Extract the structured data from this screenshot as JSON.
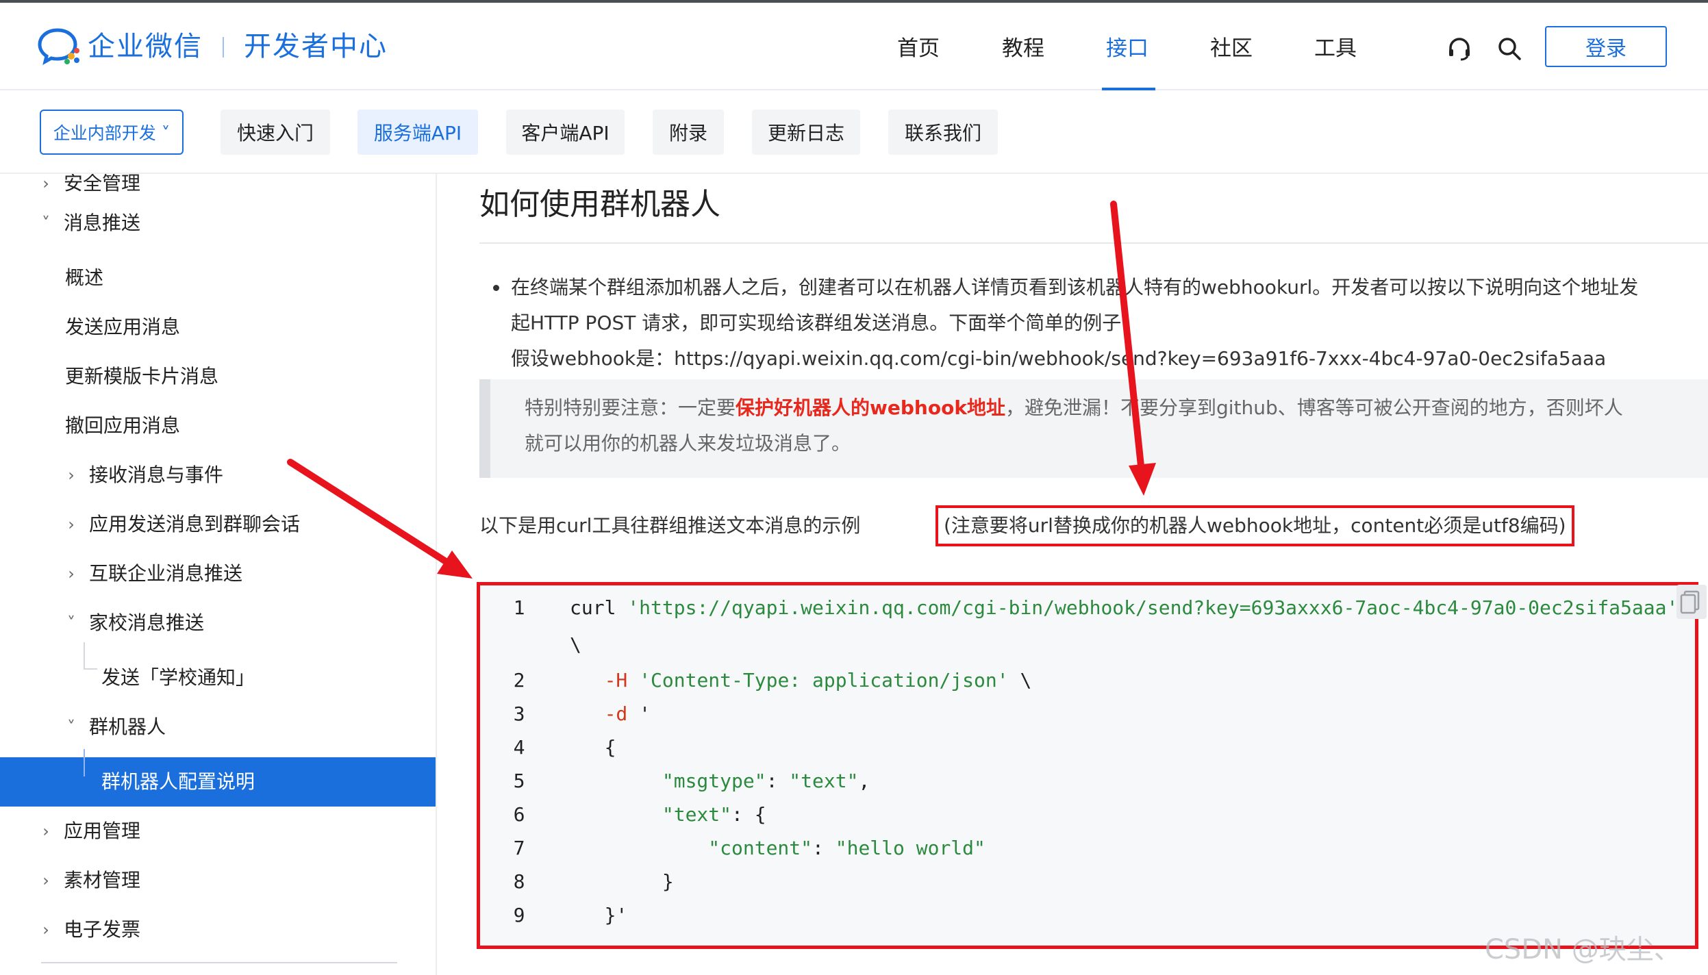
{
  "header": {
    "brand": "企业微信",
    "subbrand": "开发者中心",
    "nav": [
      "首页",
      "教程",
      "接口",
      "社区",
      "工具"
    ],
    "active_nav": "接口",
    "login": "登录",
    "icons": [
      "headset-icon",
      "search-icon"
    ]
  },
  "subnav": {
    "dev_select": "企业内部开发 ˅",
    "tabs": [
      "快速入门",
      "服务端API",
      "客户端API",
      "附录",
      "更新日志",
      "联系我们"
    ],
    "active_tab": "服务端API"
  },
  "sidebar": {
    "items": [
      {
        "label": "安全管理",
        "level": 0,
        "chevron": "›"
      },
      {
        "label": "消息推送",
        "level": 0,
        "chevron": "˅"
      },
      {
        "label": "概述",
        "level": 1,
        "chevron": ""
      },
      {
        "label": "发送应用消息",
        "level": 1,
        "chevron": ""
      },
      {
        "label": "更新模版卡片消息",
        "level": 1,
        "chevron": ""
      },
      {
        "label": "撤回应用消息",
        "level": 1,
        "chevron": ""
      },
      {
        "label": "接收消息与事件",
        "level": 1,
        "chevron": "›"
      },
      {
        "label": "应用发送消息到群聊会话",
        "level": 1,
        "chevron": "›"
      },
      {
        "label": "互联企业消息推送",
        "level": 1,
        "chevron": "›"
      },
      {
        "label": "家校消息推送",
        "level": 1,
        "chevron": "˅"
      },
      {
        "label": "发送「学校通知」",
        "level": 2,
        "chevron": ""
      },
      {
        "label": "群机器人",
        "level": 1,
        "chevron": "˅"
      },
      {
        "label": "群机器人配置说明",
        "level": 2,
        "chevron": ""
      },
      {
        "label": "应用管理",
        "level": 0,
        "chevron": "›"
      },
      {
        "label": "素材管理",
        "level": 0,
        "chevron": "›"
      },
      {
        "label": "电子发票",
        "level": 0,
        "chevron": "›"
      }
    ],
    "active_item": "群机器人配置说明"
  },
  "content": {
    "title": "如何使用群机器人",
    "para_line1": "在终端某个群组添加机器人之后，创建者可以在机器人详情页看到该机器人特有的webhookurl。开发者可以按以下说明向这个地址发",
    "para_line2": "起HTTP POST 请求，即可实现给该群组发送消息。下面举个简单的例子.",
    "para_line3": "假设webhook是：https://qyapi.weixin.qq.com/cgi-bin/webhook/send?key=693a91f6-7xxx-4bc4-97a0-0ec2sifa5aaa",
    "note_prefix": "特别特别要注意：一定要",
    "note_bold": "保护好机器人的webhook地址",
    "note_suffix": "，避免泄漏！不要分享到github、博客等可被公开查阅的地方，否则坏人",
    "note_line2": "就可以用你的机器人来发垃圾消息了。",
    "curl_intro": "以下是用curl工具往群组推送文本消息的示例",
    "curl_note": "(注意要将url替换成你的机器人webhook地址，content必须是utf8编码)"
  },
  "code": {
    "lines": [
      {
        "n": "1",
        "parts": [
          {
            "t": "curl ",
            "c": "plain"
          },
          {
            "t": "'https://qyapi.weixin.qq.com/cgi-bin/webhook/send?key=693axxx6-7aoc-4bc4-97a0-0ec2sifa5aaa'",
            "c": "str"
          }
        ]
      },
      {
        "n": "",
        "parts": [
          {
            "t": "\\",
            "c": "plain"
          }
        ]
      },
      {
        "n": "2",
        "parts": [
          {
            "t": "   -H ",
            "c": "red"
          },
          {
            "t": "'Content-Type: application/json'",
            "c": "str"
          },
          {
            "t": " \\",
            "c": "plain"
          }
        ]
      },
      {
        "n": "3",
        "parts": [
          {
            "t": "   -d ",
            "c": "red"
          },
          {
            "t": "'",
            "c": "plain"
          }
        ]
      },
      {
        "n": "4",
        "parts": [
          {
            "t": "   {",
            "c": "plain"
          }
        ]
      },
      {
        "n": "5",
        "parts": [
          {
            "t": "        \"msgtype\"",
            "c": "key"
          },
          {
            "t": ": ",
            "c": "plain"
          },
          {
            "t": "\"text\"",
            "c": "str"
          },
          {
            "t": ",",
            "c": "plain"
          }
        ]
      },
      {
        "n": "6",
        "parts": [
          {
            "t": "        \"text\"",
            "c": "key"
          },
          {
            "t": ": {",
            "c": "plain"
          }
        ]
      },
      {
        "n": "7",
        "parts": [
          {
            "t": "            \"content\"",
            "c": "key"
          },
          {
            "t": ": ",
            "c": "plain"
          },
          {
            "t": "\"hello world\"",
            "c": "str"
          }
        ]
      },
      {
        "n": "8",
        "parts": [
          {
            "t": "        }",
            "c": "plain"
          }
        ]
      },
      {
        "n": "9",
        "parts": [
          {
            "t": "   }'",
            "c": "plain"
          }
        ]
      }
    ]
  },
  "watermark": "CSDN @玦尘、",
  "colors": {
    "brand": "#1a6fdc",
    "highlight": "#e8141d",
    "string": "#2b8a3e"
  }
}
